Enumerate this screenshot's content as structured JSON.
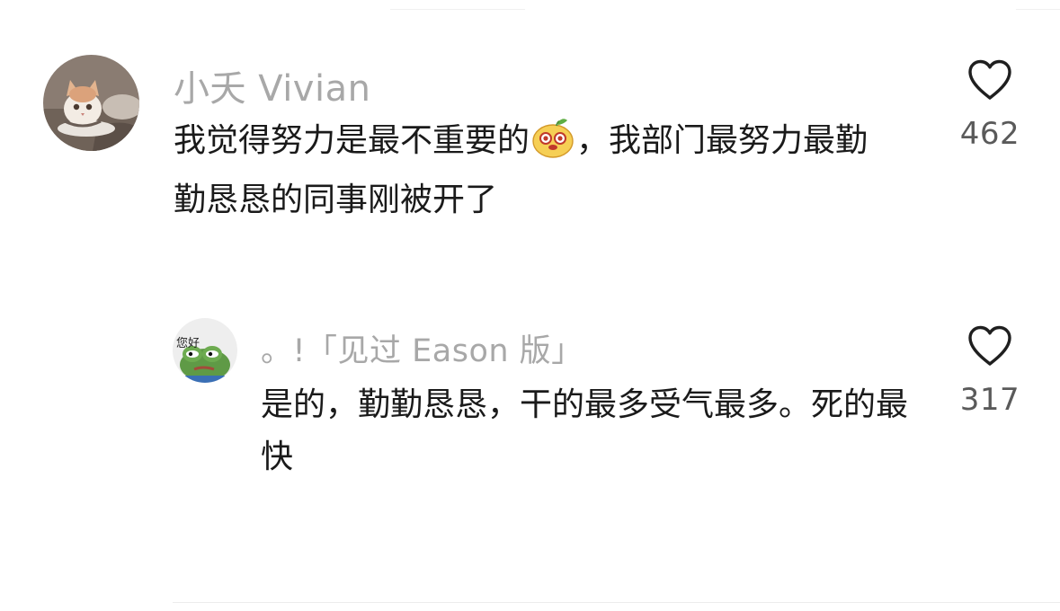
{
  "comments": [
    {
      "username": "小夭 Vivian",
      "text_part1": "我觉得努力是最不重要的",
      "text_part2": "，我部门最努力最勤勤恳恳的同事刚被开了",
      "emoji": "mango-face-emoji",
      "like_count": "462",
      "avatar": "cat-avatar"
    },
    {
      "username": "。!「见过 Eason 版」",
      "text": "是的，勤勤恳恳，干的最多受气最多。死的最快",
      "like_count": "317",
      "avatar": "frog-avatar",
      "avatar_caption": "您好"
    }
  ],
  "colors": {
    "username": "#a8a8a8",
    "text": "#1a1a1a",
    "like_count": "#5a5a5a",
    "heart_stroke": "#1f1f1f"
  }
}
